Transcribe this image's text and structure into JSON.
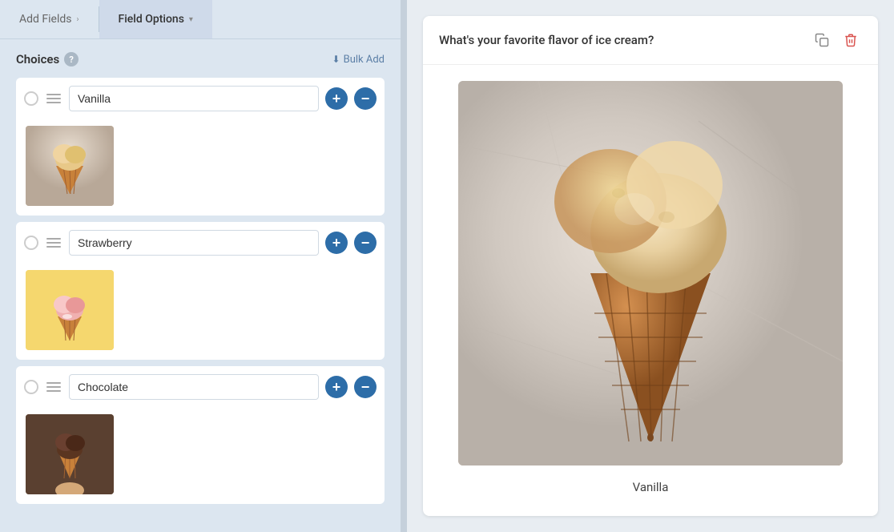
{
  "tabs": {
    "add_fields": {
      "label": "Add Fields",
      "chevron": "›"
    },
    "field_options": {
      "label": "Field Options",
      "chevron": "▾"
    }
  },
  "choices_section": {
    "label": "Choices",
    "help_tooltip": "?",
    "bulk_add_label": "Bulk Add"
  },
  "choices": [
    {
      "id": "vanilla",
      "value": "Vanilla",
      "image_type": "vanilla"
    },
    {
      "id": "strawberry",
      "value": "Strawberry",
      "image_type": "strawberry"
    },
    {
      "id": "chocolate",
      "value": "Chocolate",
      "image_type": "chocolate"
    }
  ],
  "preview": {
    "question": "What's your favorite flavor of ice cream?",
    "active_choice": "Vanilla",
    "copy_title": "Duplicate",
    "delete_title": "Delete"
  },
  "colors": {
    "accent": "#2d6da8",
    "danger": "#d9534f",
    "bg_panel": "#dce6f0"
  }
}
